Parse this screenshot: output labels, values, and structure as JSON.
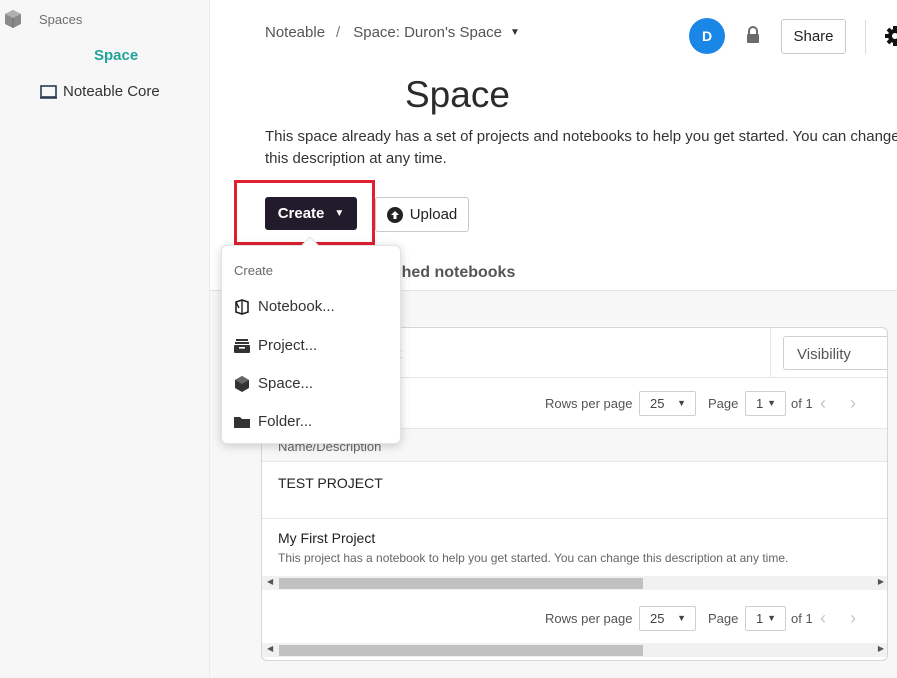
{
  "sidebar": {
    "spaces_label": "Spaces",
    "space_name": "Space",
    "core_label": "Noteable Core"
  },
  "header": {
    "breadcrumb_root": "Noteable",
    "breadcrumb_sep": "/",
    "breadcrumb_space": "Space: Duron's Space",
    "avatar_initial": "D",
    "share_label": "Share"
  },
  "main": {
    "title": "Space",
    "description": "This space already has a set of projects and notebooks to help you get started. You can change this description at any time.",
    "create_label": "Create",
    "upload_label": "Upload",
    "tab_label": "blished notebooks"
  },
  "menu": {
    "title": "Create",
    "items": [
      {
        "label": "Notebook...",
        "icon": "notebook-icon"
      },
      {
        "label": "Project...",
        "icon": "project-icon"
      },
      {
        "label": "Space...",
        "icon": "space-cube-icon"
      },
      {
        "label": "Folder...",
        "icon": "folder-icon"
      }
    ]
  },
  "table": {
    "filter_placeholder": "t",
    "visibility_label": "Visibility",
    "rows_per_page_label": "Rows per page",
    "rows_per_page_value": "25",
    "page_label": "Page",
    "page_value": "1",
    "page_of": "of 1",
    "column_header": "Name/Description",
    "rows": [
      {
        "name": "TEST PROJECT",
        "description": ""
      },
      {
        "name": "My First Project",
        "description": "This project has a notebook to help you get started. You can change this description at any time."
      }
    ]
  },
  "colors": {
    "accent_teal": "#22a39a",
    "create_button": "#221b2b",
    "avatar": "#1a87e6",
    "highlight": "#e0202e"
  }
}
